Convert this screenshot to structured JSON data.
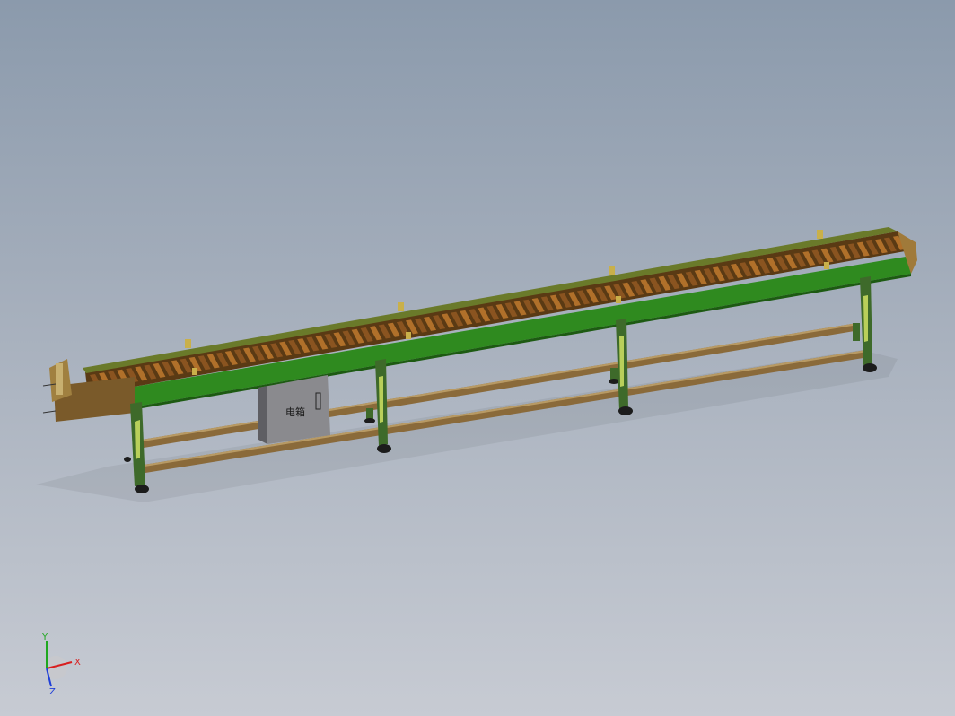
{
  "viewport": {
    "background_top": "#8b9aac",
    "background_bottom": "#c7cbd3"
  },
  "model": {
    "name": "",
    "frame_color": "#2f8a1f",
    "frame_dark": "#1d5a12",
    "chain_color": "#7a4a1a",
    "rail_color": "#8a6a3a",
    "leg_color": "#3e6a2a",
    "foot_color": "#1c1c1c",
    "cabinet_color": "#8a8a8e",
    "cabinet_label": "电箱",
    "end_plate_color": "#7a5a2a"
  },
  "triad": {
    "x_label": "X",
    "y_label": "Y",
    "z_label": "Z",
    "x_color": "#d81f1f",
    "y_color": "#1fa81f",
    "z_color": "#1f3fd8"
  }
}
